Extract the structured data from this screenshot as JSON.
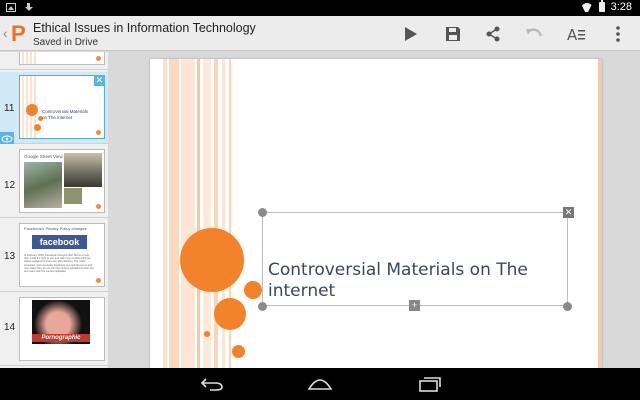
{
  "status_bar": {
    "time": "3:28"
  },
  "app": {
    "logo_letter": "P"
  },
  "document": {
    "title": "Ethical Issues in Information Technology",
    "save_status": "Saved in Drive"
  },
  "toolbar": {
    "play_icon": "play-icon",
    "save_icon": "save-icon",
    "share_icon": "share-icon",
    "undo_icon": "undo-icon",
    "format_icon": "text-format-icon",
    "overflow_icon": "more-vert-icon"
  },
  "sidebar": {
    "slides": [
      {
        "number": "11",
        "text": "Controversial Materials on The internet"
      },
      {
        "number": "12",
        "text": "Google Street View"
      },
      {
        "number": "13",
        "heading": "Facebook's Privacy Policy changes",
        "logo": "facebook",
        "body": "In February 2009, Facebook changed their Terms of Use that, it had the right to use and claim any content (pictures, status updates) forever even after deleting. The users protested, and eventually Facebook reverted the terms and now states they do not own the content uploaded to their site and users own the content uploaded."
      },
      {
        "number": "14",
        "banner": "Pornographic"
      }
    ],
    "add_label": "+"
  },
  "slide": {
    "title": "Controversial Materials on The internet"
  },
  "colors": {
    "accent": "#f4822a",
    "title_text": "#3b4660",
    "brand": "#f2701c",
    "selection": "#cfe9f7"
  }
}
